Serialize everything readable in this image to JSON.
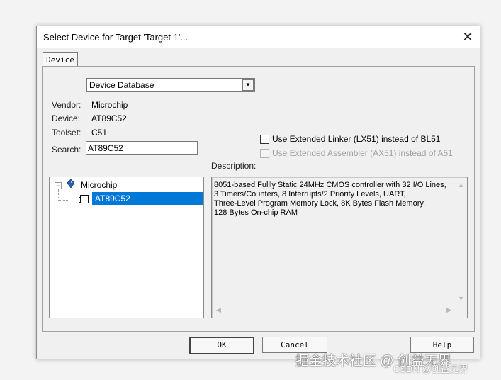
{
  "window": {
    "title": "Select Device for Target 'Target 1'...",
    "close_icon": "✕"
  },
  "tabs": [
    {
      "label": "Device"
    }
  ],
  "database_select": {
    "value": "Device Database",
    "arrow": "▼"
  },
  "info": {
    "vendor_label": "Vendor:",
    "vendor_value": "Microchip",
    "device_label": "Device:",
    "device_value": "AT89C52",
    "toolset_label": "Toolset:",
    "toolset_value": "C51",
    "search_label": "Search:",
    "search_value": "AT89C52"
  },
  "options": {
    "extended_linker": {
      "label": "Use Extended Linker (LX51) instead of BL51",
      "checked": false,
      "enabled": true
    },
    "extended_assembler": {
      "label": "Use Extended Assembler (AX51) instead of A51",
      "checked": false,
      "enabled": false
    }
  },
  "tree": {
    "toggle": "−",
    "vendor": "Microchip",
    "device": "AT89C52"
  },
  "description": {
    "label": "Description:",
    "lines": [
      "8051-based Fullly Static 24MHz CMOS controller with 32  I/O Lines,",
      "3 Timers/Counters, 8 Interrupts/2 Priority Levels, UART,",
      "Three-Level Program Memory Lock, 8K Bytes Flash Memory,",
      "128 Bytes On-chip RAM"
    ]
  },
  "buttons": {
    "ok": "OK",
    "cancel": "Cancel",
    "help": "Help"
  },
  "watermark": {
    "line1": "掘金技术社区 @ 创益无界",
    "line2": "CSDN @创益无界"
  },
  "colors": {
    "selection": "#0078d7",
    "vendor_icon": "#2b5fb4"
  }
}
